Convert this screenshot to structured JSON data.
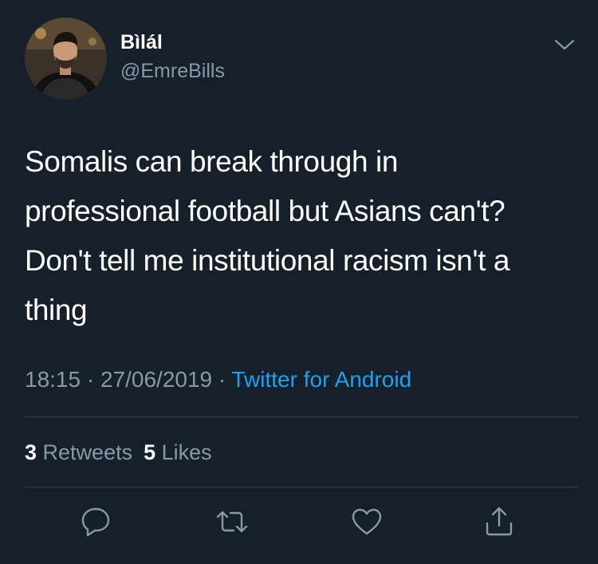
{
  "author": {
    "display_name": "Bìlál",
    "handle": "@EmreBills",
    "avatar_icon": "profile-photo"
  },
  "tweet": {
    "lines": [
      "Somalis can break through in",
      "professional football but Asians can't?",
      "Don't tell me institutional racism isn't a",
      "thing"
    ],
    "time": "18:15",
    "separator": "·",
    "date": "27/06/2019",
    "source": "Twitter for Android"
  },
  "stats": {
    "retweets_count": "3",
    "retweets_label": "Retweets",
    "likes_count": "5",
    "likes_label": "Likes"
  },
  "actions": [
    {
      "name": "reply",
      "icon": "reply-icon"
    },
    {
      "name": "retweet",
      "icon": "retweet-icon"
    },
    {
      "name": "like",
      "icon": "heart-icon"
    },
    {
      "name": "share",
      "icon": "share-icon"
    }
  ],
  "colors": {
    "background": "#15202b",
    "primary_text": "#ffffff",
    "secondary_text": "#8899a6",
    "link": "#1da1f2",
    "divider": "#38444d"
  }
}
